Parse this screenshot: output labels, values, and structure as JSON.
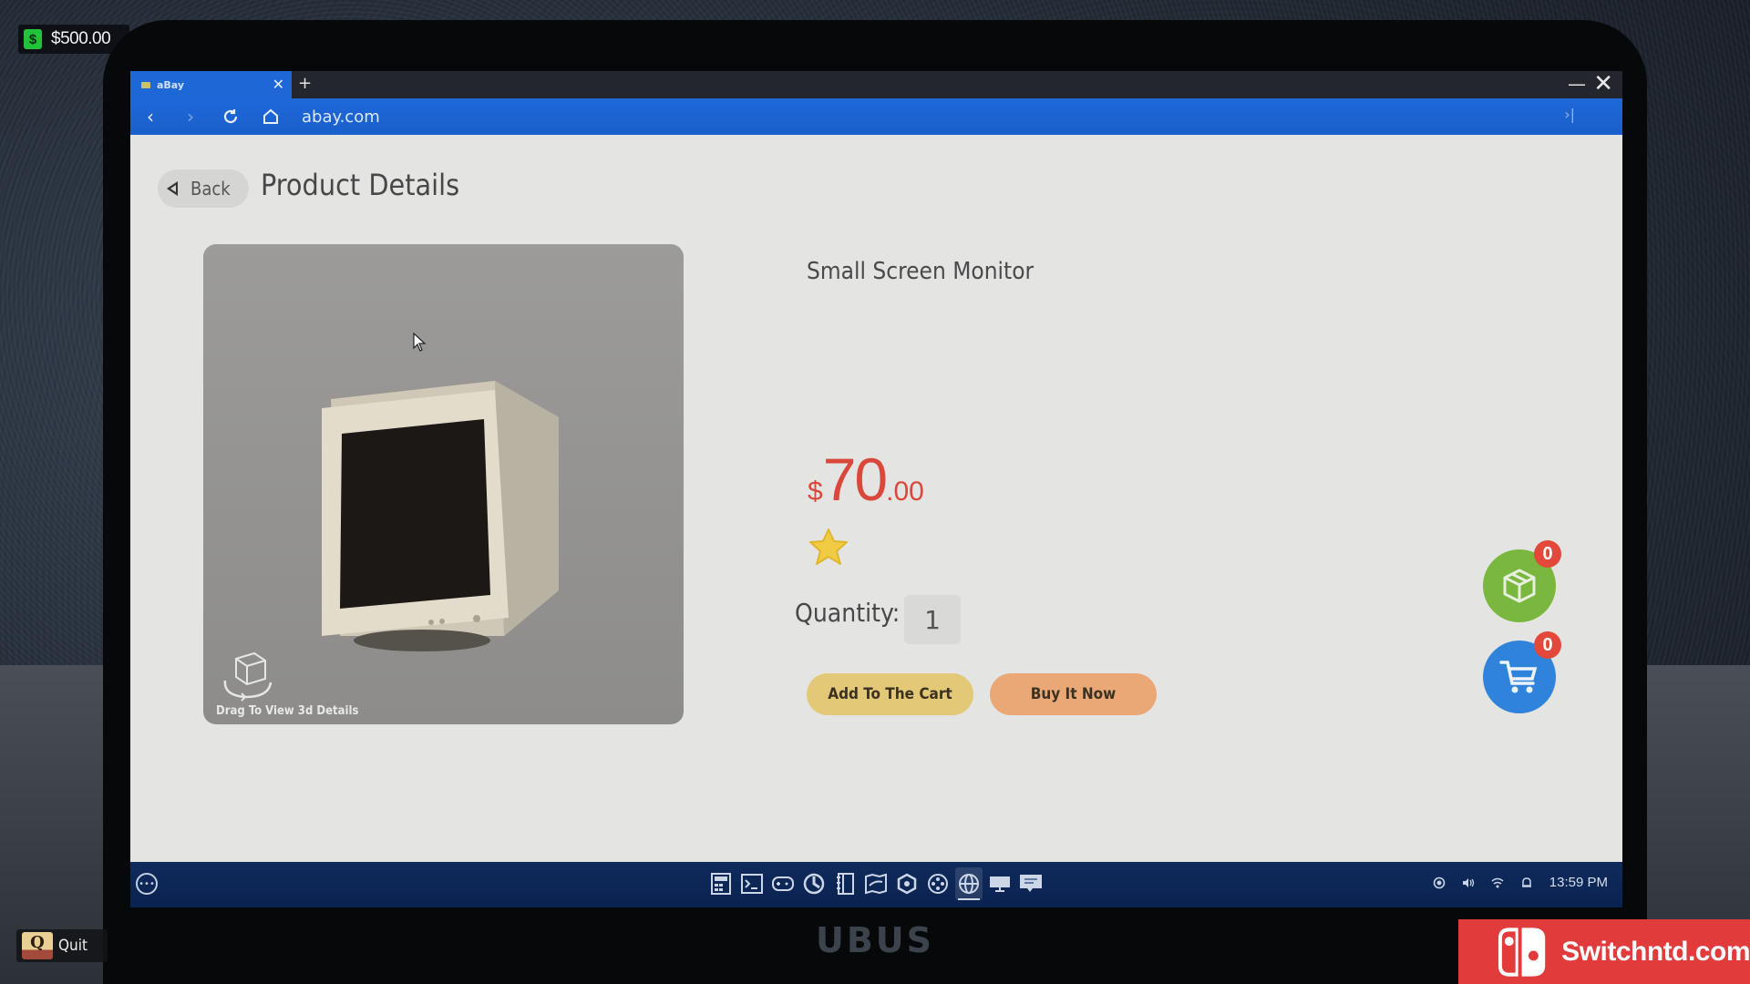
{
  "hud": {
    "money_icon": "dollar-sign-icon",
    "money": "$500.00",
    "quit_key": "Q",
    "quit_label": "Quit"
  },
  "laptop": {
    "brand": "UBUS"
  },
  "browser": {
    "tabs": [
      {
        "title": "aBay",
        "active": true
      }
    ],
    "new_tab_label": "+",
    "url": "abay.com",
    "nav_icons": [
      "back-arrow-icon",
      "forward-arrow-icon",
      "refresh-icon",
      "home-icon"
    ]
  },
  "page": {
    "back_label": "Back",
    "title": "Product Details",
    "viewer_hint": "Drag To View 3d Details",
    "product": {
      "name": "Small Screen Monitor",
      "currency": "$",
      "price_int": "70",
      "price_dec": ".00",
      "rating_stars": 1,
      "quantity_label": "Quantity:",
      "quantity": "1"
    },
    "actions": {
      "add_to_cart": "Add To The Cart",
      "buy_now": "Buy It Now"
    },
    "floating": {
      "orders_count": "0",
      "cart_count": "0"
    },
    "colors": {
      "price": "#d9483b",
      "add_to_cart": "#e3c877",
      "buy_now": "#eaa877",
      "orders_fab": "#79b73e",
      "cart_fab": "#2f83db",
      "badge": "#e2493a",
      "browser_accent": "#1d67d6"
    }
  },
  "taskbar": {
    "apps": [
      "calculator-icon",
      "terminal-icon",
      "gamepad-icon",
      "disk-utility-icon",
      "notebook-icon",
      "map-icon",
      "settings-icon",
      "media-icon",
      "browser-icon",
      "display-icon",
      "messages-icon"
    ],
    "active_app": "browser-icon",
    "tray": [
      "network-status-icon",
      "volume-icon",
      "wifi-icon",
      "notification-bell-icon"
    ],
    "clock": "13:59 PM"
  },
  "watermark": {
    "text": "Switchntd.com"
  }
}
